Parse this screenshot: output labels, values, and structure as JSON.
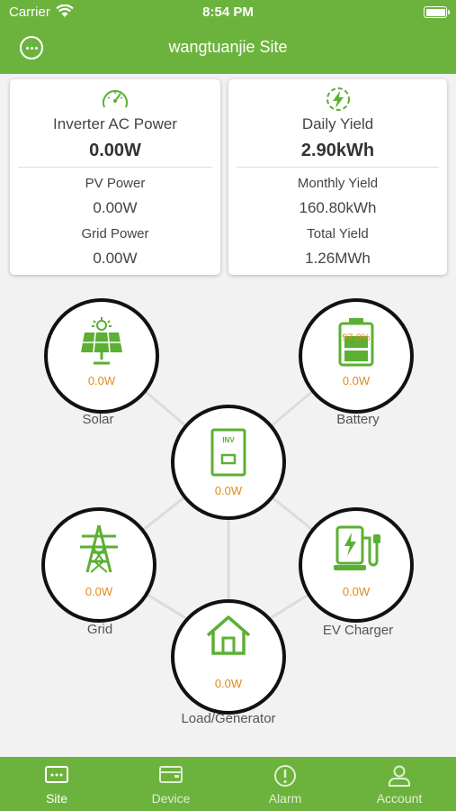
{
  "status_bar": {
    "carrier": "Carrier",
    "time": "8:54 PM"
  },
  "header": {
    "title": "wangtuanjie Site"
  },
  "power_card": {
    "icon": "speedometer-icon",
    "main_label": "Inverter AC Power",
    "main_value": "0.00W",
    "pv_label": "PV Power",
    "pv_value": "0.00W",
    "grid_label": "Grid Power",
    "grid_value": "0.00W"
  },
  "yield_card": {
    "icon": "lightning-icon",
    "daily_label": "Daily Yield",
    "daily_value": "2.90kWh",
    "monthly_label": "Monthly Yield",
    "monthly_value": "160.80kWh",
    "total_label": "Total Yield",
    "total_value": "1.26MWh"
  },
  "flow": {
    "solar": {
      "label": "Solar",
      "value": "0.0W",
      "icon": "solar-panel-icon"
    },
    "battery": {
      "label": "Battery",
      "value": "0.0W",
      "soc": "97.0%",
      "icon": "battery-icon"
    },
    "inverter": {
      "label_in_icon": "INV",
      "value": "0.0W",
      "icon": "inverter-icon"
    },
    "grid": {
      "label": "Grid",
      "value": "0.0W",
      "icon": "transmission-tower-icon"
    },
    "ev_charger": {
      "label": "EV Charger",
      "value": "0.0W",
      "icon": "ev-charger-icon"
    },
    "load": {
      "label": "Load/Generator",
      "value": "0.0W",
      "icon": "house-icon"
    }
  },
  "tabs": [
    {
      "label": "Site",
      "icon": "monitor-icon",
      "active": true
    },
    {
      "label": "Device",
      "icon": "device-icon",
      "active": false
    },
    {
      "label": "Alarm",
      "icon": "alarm-icon",
      "active": false
    },
    {
      "label": "Account",
      "icon": "user-icon",
      "active": false
    }
  ],
  "colors": {
    "brand_green": "#6cb33e",
    "icon_green": "#5bb033",
    "value_orange": "#e08a1e",
    "inactive_tab": "#dff0d2"
  }
}
